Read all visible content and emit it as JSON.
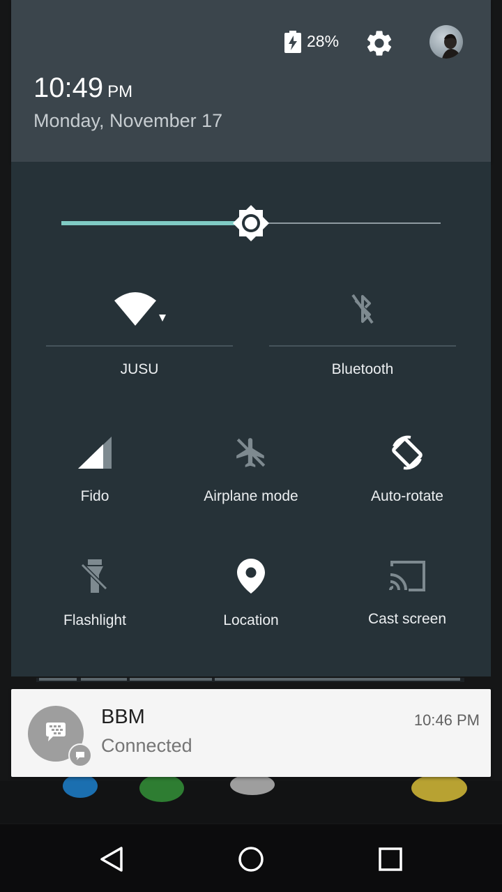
{
  "status": {
    "battery_percent": "28%",
    "time": "10:49",
    "ampm": "PM",
    "date": "Monday, November 17"
  },
  "brightness": {
    "level": 0.5
  },
  "tiles": {
    "wifi": {
      "label": "JUSU",
      "icon": "wifi-icon",
      "active": true
    },
    "bluetooth": {
      "label": "Bluetooth",
      "icon": "bluetooth-off-icon",
      "active": false
    },
    "cellular": {
      "label": "Fido",
      "icon": "signal-icon",
      "active": true
    },
    "airplane": {
      "label": "Airplane mode",
      "icon": "airplane-icon",
      "active": false
    },
    "rotate": {
      "label": "Auto-rotate",
      "icon": "auto-rotate-icon",
      "active": true
    },
    "flashlight": {
      "label": "Flashlight",
      "icon": "flashlight-off-icon",
      "active": false
    },
    "location": {
      "label": "Location",
      "icon": "location-pin-icon",
      "active": true
    },
    "cast": {
      "label": "Cast screen",
      "icon": "cast-icon",
      "active": false
    }
  },
  "notification": {
    "app": "BBM",
    "text": "Connected",
    "time": "10:46 PM",
    "icon": "bbm-chat-icon"
  },
  "colors": {
    "header_bg": "#3b454c",
    "panel_bg": "#263238",
    "accent": "#80cbc4",
    "inactive_icon": "#7e8a90",
    "active_icon": "#ffffff"
  }
}
